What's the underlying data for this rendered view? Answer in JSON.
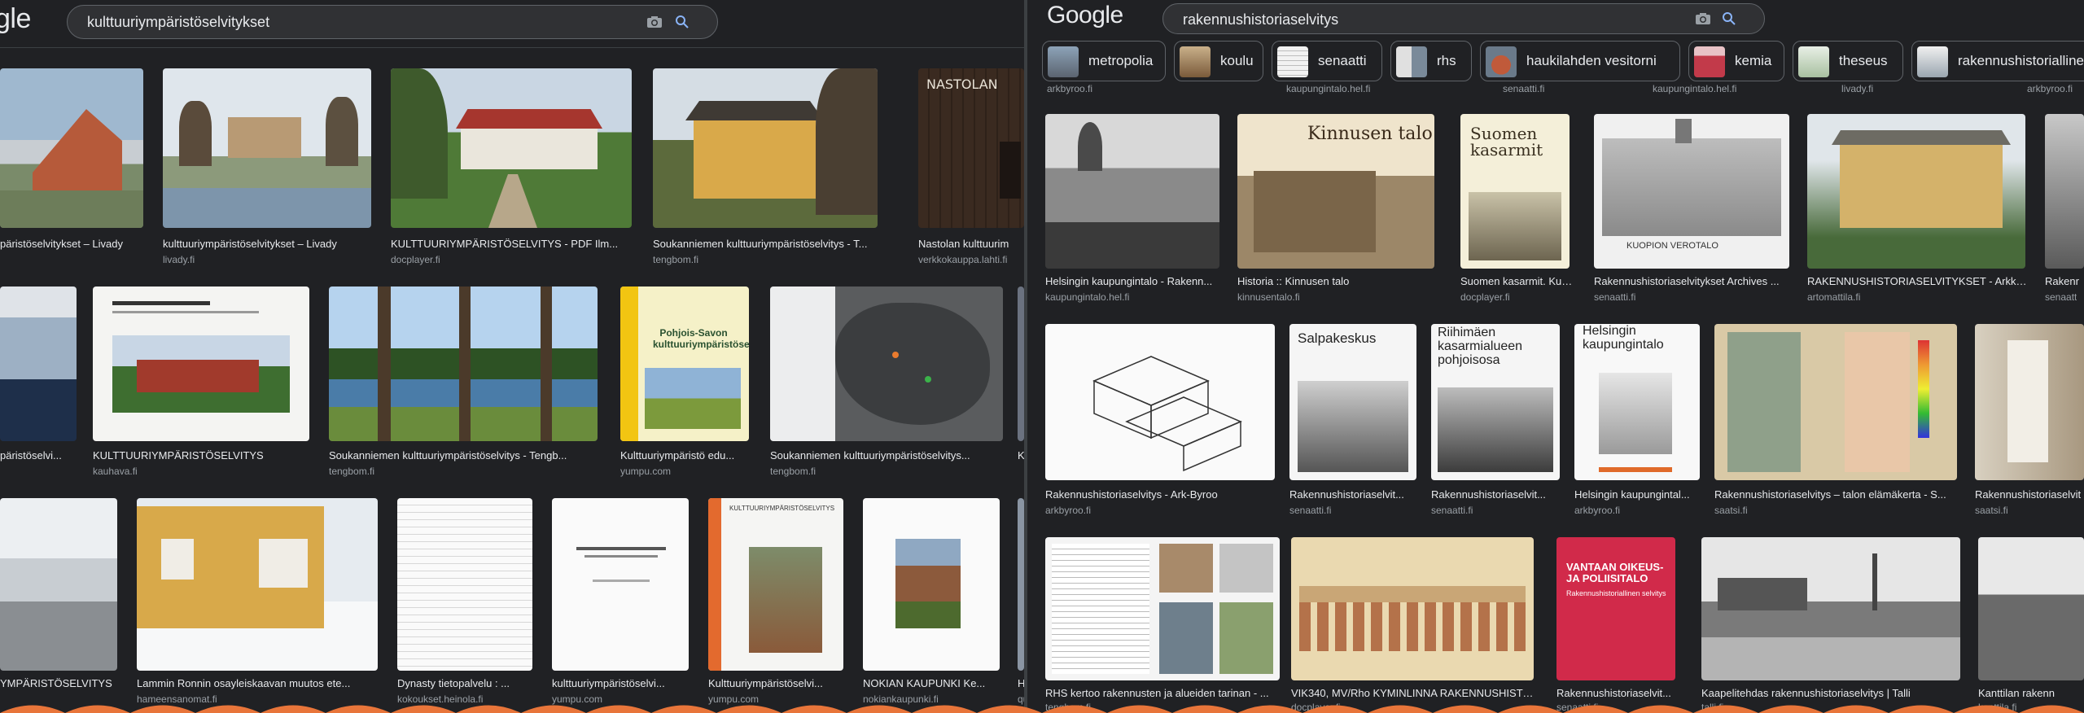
{
  "left": {
    "logo": "gle",
    "query": "kulttuuriympäristöselvitykset",
    "icons": {
      "camera": "camera-icon",
      "search": "search-icon"
    },
    "rows": [
      [
        {
          "caption": "päristöselvitykset – Livady",
          "source": ""
        },
        {
          "caption": "kulttuuriympäristöselvitykset – Livady",
          "source": "livady.fi"
        },
        {
          "caption": "KULTTUURIYMPÄRISTÖSELVITYS - PDF Ilm...",
          "source": "docplayer.fi"
        },
        {
          "caption": "Soukanniemen kulttuuriympäristöselvitys - T...",
          "source": "tengbom.fi"
        },
        {
          "caption": "Nastolan kulttuurim",
          "source": "verkkokauppa.lahti.fi"
        }
      ],
      [
        {
          "caption": "päristöselvi...",
          "source": ""
        },
        {
          "caption": "KULTTUURIYMPÄRISTÖSELVITYS",
          "source": "kauhava.fi"
        },
        {
          "caption": "Soukanniemen kulttuuriympäristöselvitys - Tengb...",
          "source": "tengbom.fi"
        },
        {
          "caption": "Kulttuuriympäristö edu...",
          "source": "yumpu.com"
        },
        {
          "caption": "Soukanniemen kulttuuriympäristöselvitys...",
          "source": "tengbom.fi"
        },
        {
          "caption": "K",
          "source": ""
        }
      ],
      [
        {
          "caption": "YMPÄRISTÖSELVITYS",
          "source": ""
        },
        {
          "caption": "Lammin Ronnin osayleiskaavan muutos ete...",
          "source": "hameensanomat.fi"
        },
        {
          "caption": "Dynasty tietopalvelu : ...",
          "source": "kokoukset.heinola.fi"
        },
        {
          "caption": "kulttuuriympäristöselvi...",
          "source": "yumpu.com"
        },
        {
          "caption": "Kulttuuriympäristöselvi...",
          "source": "yumpu.com"
        },
        {
          "caption": "NOKIAN KAUPUNKI Ke...",
          "source": "nokiankaupunki.fi"
        },
        {
          "caption": "Ha",
          "source": "qu"
        }
      ]
    ],
    "image_texts": {
      "nastola": "NASTOLAN",
      "pohjois": "Pohjois-Savon kulttuuriympäristöselvitys",
      "kulttuuri_doc": "KULTTUURIYMPÄRISTÖSELVITYS"
    }
  },
  "right": {
    "logo": "Google",
    "query": "rakennushistoriaselvitys",
    "icons": {
      "camera": "camera-icon",
      "search": "search-icon"
    },
    "chips": [
      "metropolia",
      "koulu",
      "senaatti",
      "rhs",
      "haukilahden vesitorni",
      "kemia",
      "theseus",
      "rakennushistoriallinen s"
    ],
    "chip_sources": [
      "arkbyroo.fi",
      "kaupungintalo.hel.fi",
      "senaatti.fi",
      "kaupungintalo.hel.fi",
      "livady.fi",
      "arkbyroo.fi"
    ],
    "rows": [
      [
        {
          "caption": "Helsingin kaupungintalo - Rakenn...",
          "source": "kaupungintalo.hel.fi"
        },
        {
          "caption": "Historia :: Kinnusen talo",
          "source": "kinnusentalo.fi"
        },
        {
          "caption": "Suomen kasarmit. Kult...",
          "source": "docplayer.fi"
        },
        {
          "caption": "Rakennushistoriaselvitykset Archives ...",
          "source": "senaatti.fi"
        },
        {
          "caption": "RAKENNUSHISTORIASELVITYKSET - Arkkit...",
          "source": "artomattila.fi"
        },
        {
          "caption": "Rakenr",
          "source": "senaatt"
        }
      ],
      [
        {
          "caption": "Rakennushistoriaselvitys - Ark-Byroo",
          "source": "arkbyroo.fi"
        },
        {
          "caption": "Rakennushistoriaselvit...",
          "source": "senaatti.fi"
        },
        {
          "caption": "Rakennushistoriaselvit...",
          "source": "senaatti.fi"
        },
        {
          "caption": "Helsingin kaupungintal...",
          "source": "arkbyroo.fi"
        },
        {
          "caption": "Rakennushistoriaselvitys – talon elämäkerta - S...",
          "source": "saatsi.fi"
        },
        {
          "caption": "Rakennushistoriaselvit",
          "source": "saatsi.fi"
        }
      ],
      [
        {
          "caption": "RHS kertoo rakennusten ja alueiden tarinan - ...",
          "source": "tengbom.fi"
        },
        {
          "caption": "VIK340, MV/Rho KYMINLINNA RAKENNUSHISTORIASEL...",
          "source": "docplayer.fi"
        },
        {
          "caption": "Rakennushistoriaselvit...",
          "source": "senaatti.fi"
        },
        {
          "caption": "Kaapelitehdas rakennushistoriaselvitys | Talli",
          "source": "talli.fi"
        },
        {
          "caption": "Kanttilan rakenn",
          "source": "kanttila.fi"
        }
      ]
    ],
    "image_texts": {
      "kinnusen": "Kinnusen talo",
      "suomen": "Suomen kasarmit",
      "kuopion": "KUOPION VEROTALO",
      "salpakeskus": "Salpakeskus",
      "riihimaen": "Riihimäen kasarmialueen pohjoisosa",
      "helsingin": "Helsingin kaupungintalo",
      "vantaan": "VANTAAN OIKEUS- JA POLIISITALO",
      "vantaan_sub": "Rakennushistoriallinen selvitys"
    }
  },
  "colors": {
    "background": "#202124",
    "text": "#e8eaed",
    "secondary": "#9aa0a6",
    "accent": "#8ab4f8",
    "search_bg": "#303134",
    "wave": "#e8753a"
  }
}
